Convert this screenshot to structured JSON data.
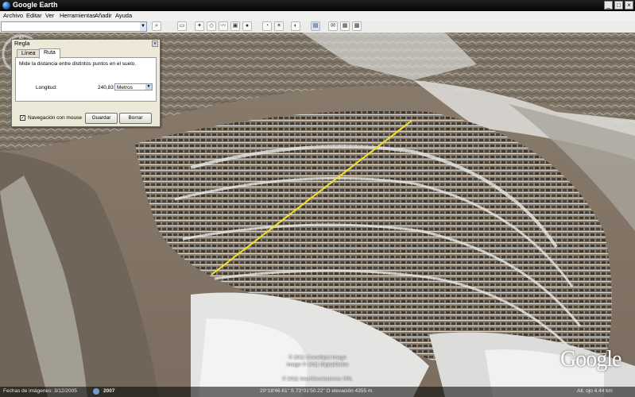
{
  "window": {
    "title": "Google Earth"
  },
  "menu": [
    "Archivo",
    "Editar",
    "Ver",
    "Herramientas",
    "Añadir",
    "Ayuda"
  ],
  "toolbar": {
    "search_icon": "magnifier-icon",
    "buttons": [
      "sidebar-toggle-icon",
      "placemark-icon",
      "polygon-icon",
      "path-icon",
      "image-overlay-icon",
      "record-tour-icon",
      "historical-imagery-icon",
      "sun-icon",
      "planets-icon",
      "ruler-icon",
      "email-icon",
      "print-icon",
      "view-in-maps-icon"
    ]
  },
  "ruler": {
    "title": "Regla",
    "close": "×",
    "tabs": [
      "Línea",
      "Ruta"
    ],
    "active_tab": "Ruta",
    "description": "Mide la distancia entre distintos puntos en el suelo.",
    "length_label": "Longitud:",
    "length_value": "240,83",
    "unit": "Metros",
    "mouse_nav_label": "Navegación con mouse",
    "mouse_nav_checked": true,
    "save_label": "Guardar",
    "clear_label": "Borrar"
  },
  "overlay": {
    "copyright_1": "© 2011 Cnes/Spot Image",
    "copyright_2": "Image © 2011 DigitalGlobe",
    "copyright_3": "© 2011 Inav/Geosistemas SRL",
    "logo_text": "Google"
  },
  "status": {
    "imagery_date": "Fechas de imágenes: 3/12/2005",
    "year": "2007",
    "coords": "20°18'46.61\" S   73°01'50.22\" O   elevación 4355 m",
    "eye_alt": "Alt. ojo  4.44 km"
  },
  "colors": {
    "ruler_line": "#f2e12a",
    "titlebar": "#0a0a0a",
    "dialog_bg": "#ece9d8"
  }
}
